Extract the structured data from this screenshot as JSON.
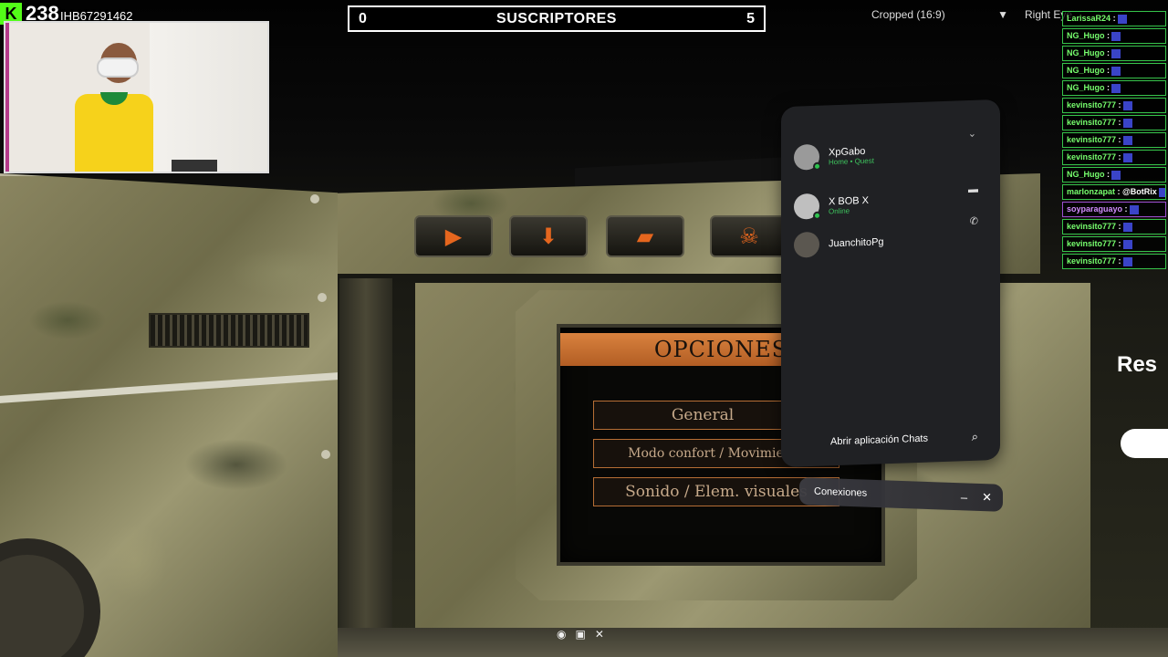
{
  "overlay": {
    "follower_count": "238",
    "stream_code": "IHB67291462",
    "subs_goal": {
      "left": "0",
      "title": "SUSCRIPTORES",
      "right": "5"
    },
    "view_mode": "Cropped (16:9)",
    "eye": "Right Eye"
  },
  "game_menu": {
    "title": "OPCIONES",
    "items": [
      "General",
      "Modo confort / Movimiento",
      "Sonido / Elem. visuales"
    ],
    "tab_icons": [
      "play-icon",
      "download-icon",
      "gun-icon",
      "skull-icon"
    ]
  },
  "social_panel": {
    "friends": [
      {
        "name": "XpGabo",
        "status": "Home • Quest"
      },
      {
        "name": "X BOB X",
        "status": "Online"
      },
      {
        "name": "JuanchitoPg",
        "status": ""
      }
    ],
    "open_chats_label": "Abrir aplicación Chats",
    "connections_label": "Conexiones"
  },
  "chat": [
    {
      "user": "LarissaR24",
      "msg": ":"
    },
    {
      "user": "NG_Hugo",
      "msg": ":"
    },
    {
      "user": "NG_Hugo",
      "msg": ":"
    },
    {
      "user": "NG_Hugo",
      "msg": ":"
    },
    {
      "user": "NG_Hugo",
      "msg": ":"
    },
    {
      "user": "kevinsito777",
      "msg": ":"
    },
    {
      "user": "kevinsito777",
      "msg": ":"
    },
    {
      "user": "kevinsito777",
      "msg": ":"
    },
    {
      "user": "kevinsito777",
      "msg": ":"
    },
    {
      "user": "NG_Hugo",
      "msg": ":"
    },
    {
      "user": "marlonzapat",
      "msg": ": @BotRix"
    },
    {
      "user": "soyparaguayo",
      "msg": ":"
    },
    {
      "user": "kevinsito777",
      "msg": ":"
    },
    {
      "user": "kevinsito777",
      "msg": ":"
    },
    {
      "user": "kevinsito777",
      "msg": ":"
    }
  ],
  "side_text": "Res"
}
